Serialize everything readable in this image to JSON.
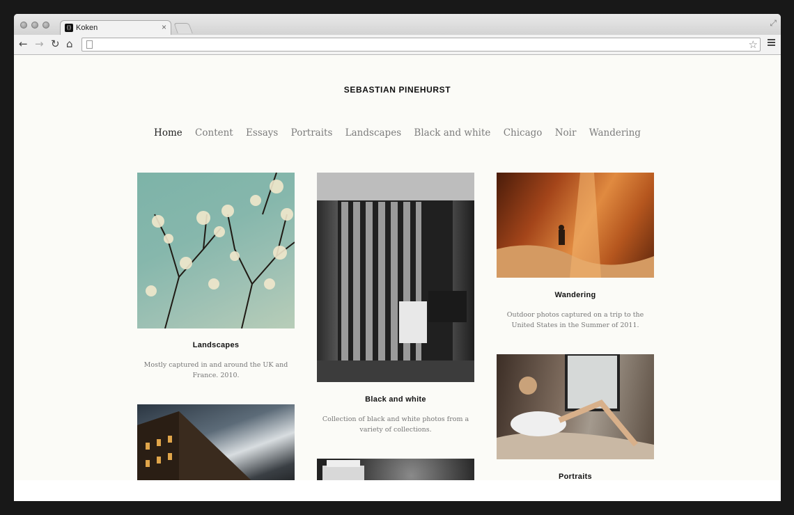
{
  "browser": {
    "tab_title": "Koken",
    "tab_close": "×",
    "favicon_glyph": "()",
    "address": ""
  },
  "site": {
    "title": "SEBASTIAN PINEHURST",
    "nav": [
      "Home",
      "Content",
      "Essays",
      "Portraits",
      "Landscapes",
      "Black and white",
      "Chicago",
      "Noir",
      "Wandering"
    ],
    "active_nav": "Home"
  },
  "cards": {
    "landscapes": {
      "title": "Landscapes",
      "desc": "Mostly captured in and around the UK and France. 2010."
    },
    "black_and_white": {
      "title": "Black and white",
      "desc": "Collection of black and white photos from a variety of collections."
    },
    "wandering": {
      "title": "Wandering",
      "desc": "Outdoor photos captured on a trip to the United States in the Summer of 2011."
    },
    "portraits": {
      "title": "Portraits"
    }
  },
  "icons": {
    "back": "back-arrow-icon",
    "forward": "forward-arrow-icon",
    "reload": "reload-icon",
    "home": "home-icon",
    "bookmark": "star-icon",
    "menu": "hamburger-menu-icon"
  }
}
